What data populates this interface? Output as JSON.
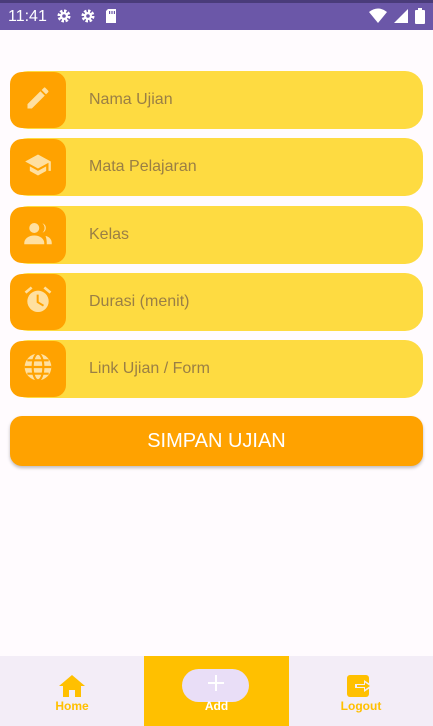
{
  "status_bar": {
    "time": "11:41",
    "left_icons": [
      "gear-icon",
      "gear-icon",
      "sd-card-icon"
    ],
    "right_icons": [
      "wifi-icon",
      "signal-icon",
      "battery-icon"
    ]
  },
  "form": {
    "fields": [
      {
        "label": "Nama Ujian",
        "icon": "pencil-icon"
      },
      {
        "label": "Mata Pelajaran",
        "icon": "graduation-cap-icon"
      },
      {
        "label": "Kelas",
        "icon": "people-icon"
      },
      {
        "label": "Durasi (menit)",
        "icon": "alarm-clock-icon"
      },
      {
        "label": "Link Ujian / Form",
        "icon": "globe-icon"
      }
    ],
    "save_label": "SIMPAN UJIAN"
  },
  "bottom_nav": {
    "items": [
      {
        "label": "Home",
        "icon": "home-icon"
      },
      {
        "label": "Add",
        "icon": "plus-icon"
      },
      {
        "label": "Logout",
        "icon": "logout-icon"
      }
    ],
    "selected": "Add"
  },
  "colors": {
    "status_bar": "#6b57a8",
    "field_bg": "#fedb41",
    "icon_box": "#ffa200",
    "button": "#ffa200",
    "nav_active": "#ffc000",
    "nav_bg": "#f3edf7",
    "label_text": "#9a7f45"
  }
}
